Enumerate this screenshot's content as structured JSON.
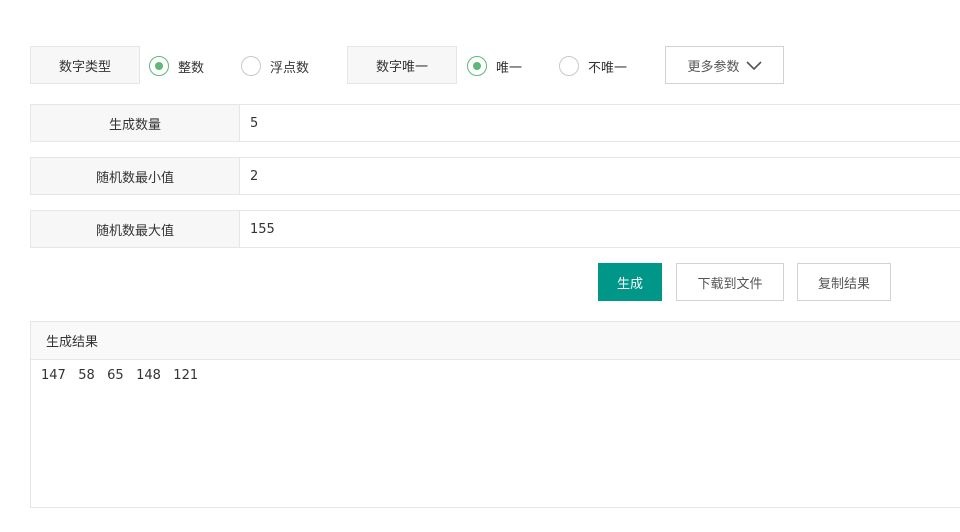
{
  "options": {
    "number_type": {
      "label": "数字类型",
      "choices": [
        {
          "label": "整数",
          "checked": true
        },
        {
          "label": "浮点数",
          "checked": false
        }
      ]
    },
    "unique": {
      "label": "数字唯一",
      "choices": [
        {
          "label": "唯一",
          "checked": true
        },
        {
          "label": "不唯一",
          "checked": false
        }
      ]
    },
    "more_label": "更多参数",
    "more_icon": "chevron-down-icon"
  },
  "form": {
    "count": {
      "label": "生成数量",
      "value": "5"
    },
    "min": {
      "label": "随机数最小值",
      "value": "2"
    },
    "max": {
      "label": "随机数最大值",
      "value": "155"
    }
  },
  "actions": {
    "generate": "生成",
    "download": "下载到文件",
    "copy": "复制结果"
  },
  "result": {
    "title": "生成结果",
    "content": "147   58   65   148   121"
  },
  "colors": {
    "primary": "#009688",
    "radio_checked": "#5fb878",
    "label_bg": "#f7f7f7",
    "border": "#e6e6e6"
  }
}
